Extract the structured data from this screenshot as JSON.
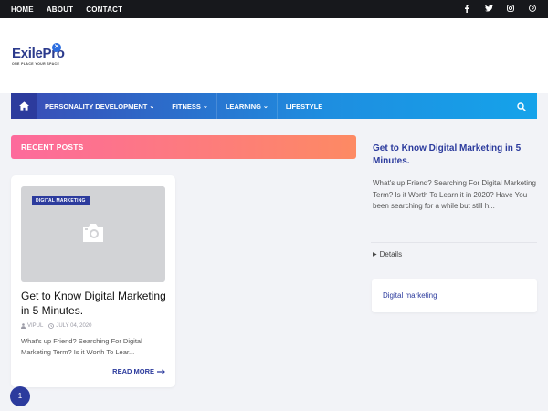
{
  "topbar": {
    "links": [
      "HOME",
      "ABOUT",
      "CONTACT"
    ],
    "social_icons": [
      "facebook-icon",
      "twitter-icon",
      "instagram-icon",
      "pinterest-icon"
    ]
  },
  "logo": {
    "name": "ExilePro",
    "tagline": "ONE PLACE YOUR SPACE"
  },
  "nav": {
    "items": [
      {
        "label": "PERSONALITY DEVELOPMENT",
        "dropdown": true
      },
      {
        "label": "FITNESS",
        "dropdown": true
      },
      {
        "label": "LEARNING",
        "dropdown": true
      },
      {
        "label": "LIFESTYLE",
        "dropdown": false
      }
    ]
  },
  "section": {
    "recent_title": "RECENT POSTS"
  },
  "post": {
    "label": "DIGITAL MARKETING",
    "title": "Get to Know Digital Marketing in 5 Minutes.",
    "author": "VIPUL",
    "date": "JULY 04, 2020",
    "excerpt": "What's up Friend? Searching For Digital Marketing Term? Is it Worth To Lear...",
    "read_more": "READ MORE"
  },
  "pagination": {
    "current": "1"
  },
  "sidebar": {
    "featured_title": "Get to Know Digital Marketing in 5 Minutes.",
    "featured_excerpt": "What's up Friend? Searching For Digital Marketing Term? Is it Worth To Learn it in 2020? Have You been searching for a while but still h...",
    "details_label": "Details",
    "label_link": "Digital marketing"
  },
  "colors": {
    "primary": "#2c3b9d",
    "accent_pink": "#fd6a9c",
    "accent_orange": "#fd8a63",
    "topbar": "#17181c"
  }
}
